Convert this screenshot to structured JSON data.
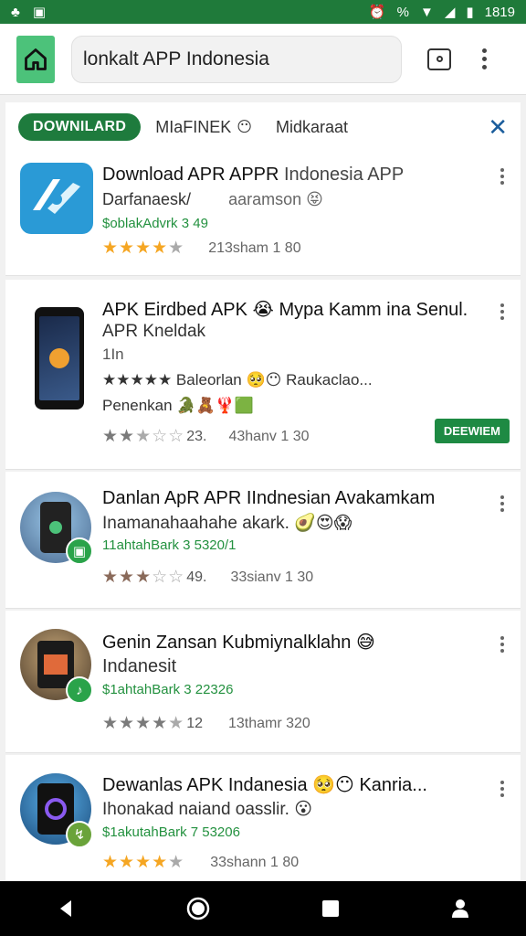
{
  "status_bar": {
    "time": "1819",
    "percent": "%"
  },
  "toolbar": {
    "search_text": "lonkalt APP Indonesia"
  },
  "chips": {
    "active": "DOWNILARD",
    "second": "MIaFINEK",
    "third": "Midkaraat"
  },
  "apps": [
    {
      "title": "Download APR APPR",
      "title_tail": "Indonesia APP",
      "line2": "Darfanaesk/",
      "line2_tail": "aaramson 😝",
      "green": "$oblakAdvrk 3 49",
      "stars_on": "★★★★",
      "stars_off": "★",
      "meta": "213sham 1 80"
    },
    {
      "title": "APK Eirdbed APK 😭 Mypa Kamm ina Senul..",
      "line2": "APR Kneldak",
      "line3": "1In",
      "feature": "★★★★★ Baleorlan 🥺😶 Raukaclao...",
      "line4": "Penenkan 🐊🧸🦞🟩",
      "stars_on": "★★",
      "stars_off": "★☆☆",
      "meta_a": "23.",
      "meta": "43hanv 1 30",
      "install": "DEEWIEM"
    },
    {
      "title": "Danlan ApR APR IIndnesian Avakamkam",
      "line2": "Inamanahaahahe akark. 🥑😍😱",
      "green": "11ahtahBark 3 5320/1",
      "stars_on": "★★★",
      "stars_off": "☆☆",
      "meta_a": "49.",
      "meta": "33sianv 1 30"
    },
    {
      "title": "Genin Zansan Kubmiynalklahn 😅",
      "line2": "Indanesit",
      "green": "$1ahtahBark 3 22326",
      "stars_on": "★★★★",
      "stars_off": "★",
      "meta_a": "12",
      "meta": "13thamr 320"
    },
    {
      "title": "Dewanlas APK Indanesia 🥺😶 Kanria...",
      "line2": "Ihonakad naiand oasslir. 😮",
      "green": "$1akutahBark 7 53206",
      "stars_on": "★★★★",
      "stars_off": "★",
      "meta": "33shann 1 80"
    }
  ]
}
